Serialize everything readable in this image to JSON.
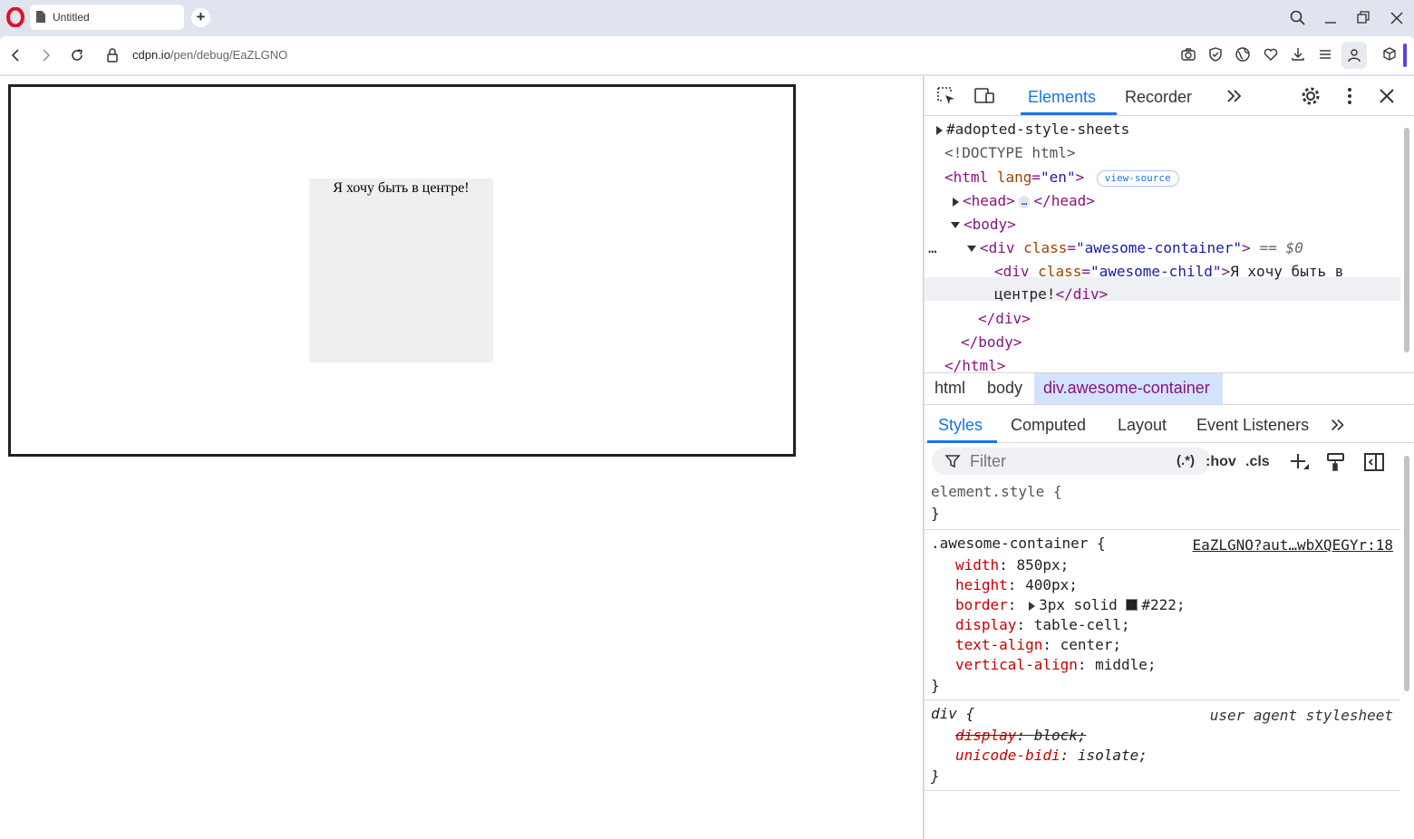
{
  "browser": {
    "tab_title": "Untitled",
    "url_host": "cdpn.io",
    "url_path": "/pen/debug/EaZLGNO"
  },
  "page": {
    "child_text": "Я хочу быть в центре!"
  },
  "devtools": {
    "tabs": [
      "Elements",
      "Recorder"
    ],
    "dom": {
      "adopted": "#adopted-style-sheets",
      "doctype": "<!DOCTYPE html>",
      "html_open_tag": "<html",
      "html_attr": "lang",
      "html_eq": "=",
      "html_attr_val": "\"en\"",
      "html_close_bracket": ">",
      "view_source": "view-source",
      "head_open": "<head>",
      "head_ellipsis": "…",
      "head_close": "</head>",
      "body_open": "<body>",
      "row_dots": "…",
      "div_open": "<div",
      "class_attr": "class",
      "container_class": "\"awesome-container\"",
      "eq0": "== $0",
      "child_class": "\"awesome-child\"",
      "child_text_line1": "Я хочу быть в",
      "child_text_line2": "центре!",
      "div_close": "</div>",
      "body_close": "</body>",
      "html_close": "</html>"
    },
    "breadcrumb": [
      "html",
      "body",
      "div.awesome-container"
    ],
    "styles_tabs": [
      "Styles",
      "Computed",
      "Layout",
      "Event Listeners"
    ],
    "filter_placeholder": "Filter",
    "filter_buttons": {
      "regex": "(.*)",
      "hov": ":hov",
      "cls": ".cls"
    },
    "rules": {
      "element_style_selector": "element.style {",
      "close_brace": "}",
      "container_selector": ".awesome-container {",
      "container_source": "EaZLGNO?aut…wbXQEGYr:18",
      "container_props": [
        {
          "name": "width",
          "value": "850px;"
        },
        {
          "name": "height",
          "value": "400px;"
        },
        {
          "name": "border",
          "value": "3px solid #222;"
        },
        {
          "name": "display",
          "value": "table-cell;"
        },
        {
          "name": "text-align",
          "value": "center;"
        },
        {
          "name": "vertical-align",
          "value": "middle;"
        }
      ],
      "div_selector": "div {",
      "div_source": "user agent stylesheet",
      "div_props": [
        {
          "name": "display",
          "value": "block;"
        },
        {
          "name": "unicode-bidi",
          "value": "isolate;"
        }
      ]
    }
  },
  "colors": {
    "accent": "#1a73e8",
    "tag": "#881280",
    "attr": "#994500",
    "attr_value": "#1a1aa6",
    "prop": "#c80000",
    "swatch": "#222222"
  }
}
